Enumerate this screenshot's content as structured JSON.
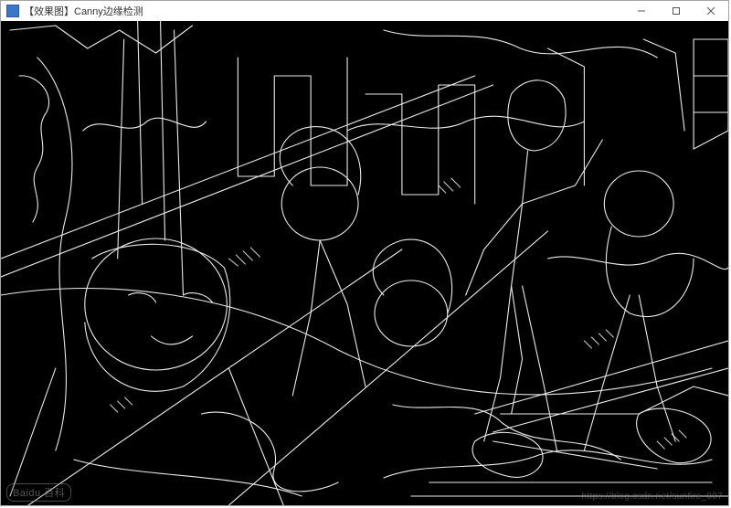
{
  "window": {
    "icon_name": "app-icon",
    "title": "【效果图】Canny边缘检测",
    "controls": {
      "minimize_name": "minimize-icon",
      "maximize_name": "maximize-icon",
      "close_name": "close-icon"
    }
  },
  "content": {
    "description": "Canny edge-detected anime scene",
    "bg_color": "#000000",
    "stroke_color": "#ffffff"
  },
  "watermarks": {
    "bottom_left": "Baidu 百科",
    "bottom_right": "https://blog.csdn.net/sunfire_007"
  }
}
